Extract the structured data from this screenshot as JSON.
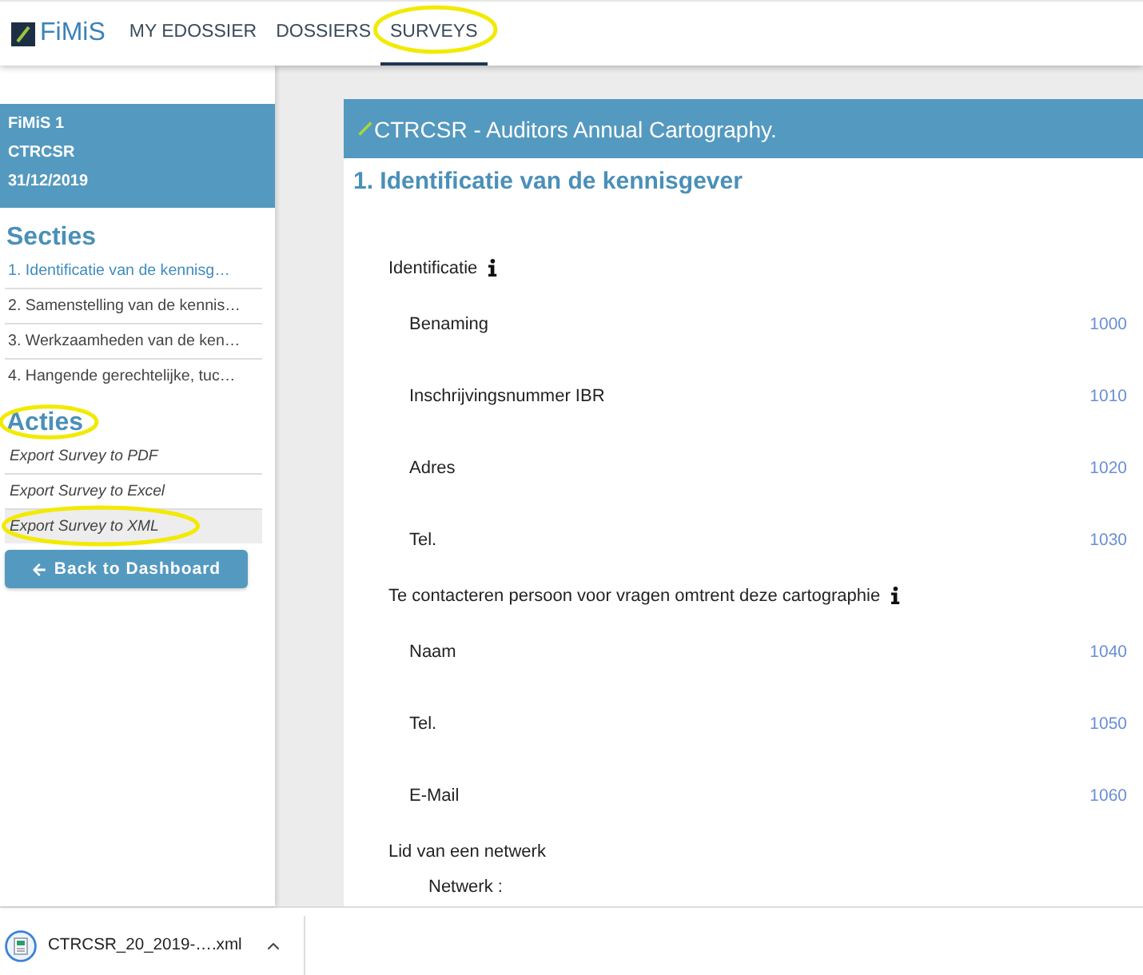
{
  "header": {
    "logo": "FiMiS",
    "nav": [
      {
        "label": "MY EDOSSIER",
        "selected": false,
        "highlighted": false
      },
      {
        "label": "DOSSIERS",
        "selected": false,
        "highlighted": false
      },
      {
        "label": "SURVEYS",
        "selected": true,
        "highlighted": true
      }
    ]
  },
  "sidebar": {
    "info_lines": [
      "FiMiS 1",
      "CTRCSR",
      "31/12/2019"
    ],
    "sections": {
      "title": "Secties",
      "highlighted": false,
      "items": [
        {
          "label": "1. Identificatie van de kennisg…",
          "selected": true
        },
        {
          "label": "2. Samenstelling van de kennis…",
          "selected": false
        },
        {
          "label": "3. Werkzaamheden van de ken…",
          "selected": false
        },
        {
          "label": "4. Hangende gerechtelijke, tuc…",
          "selected": false
        }
      ]
    },
    "actions": {
      "title": "Acties",
      "highlighted": true,
      "items": [
        {
          "label": "Export Survey to PDF",
          "hovered": false,
          "highlighted": false
        },
        {
          "label": "Export Survey to Excel",
          "hovered": false,
          "highlighted": false
        },
        {
          "label": "Export Survey to XML",
          "hovered": true,
          "highlighted": true
        }
      ]
    },
    "back_button": "Back to Dashboard"
  },
  "survey": {
    "title": "CTRCSR - Auditors Annual Cartography.",
    "section_title": "1. Identificatie van de kennisgever",
    "groups": [
      {
        "label": "Identificatie",
        "info": true,
        "fields": [
          {
            "kind": "coded",
            "label": "Benaming",
            "code": "1000"
          },
          {
            "kind": "coded",
            "label": "Inschrijvingsnummer IBR",
            "code": "1010"
          },
          {
            "kind": "coded",
            "label": "Adres",
            "code": "1020"
          },
          {
            "kind": "coded",
            "label": "Tel.",
            "code": "1030"
          }
        ]
      },
      {
        "label": "Te contacteren persoon voor vragen omtrent deze cartographie",
        "info": true,
        "fields": [
          {
            "kind": "coded",
            "label": "Naam",
            "code": "1040"
          },
          {
            "kind": "coded",
            "label": "Tel.",
            "code": "1050"
          },
          {
            "kind": "coded",
            "label": "E-Mail",
            "code": "1060"
          }
        ]
      },
      {
        "label": "Lid van een netwerk",
        "info": false,
        "fields": [
          {
            "kind": "inline",
            "label": "Netwerk :"
          }
        ]
      }
    ]
  },
  "download_bar": {
    "filename": "CTRCSR_20_2019-….xml"
  }
}
